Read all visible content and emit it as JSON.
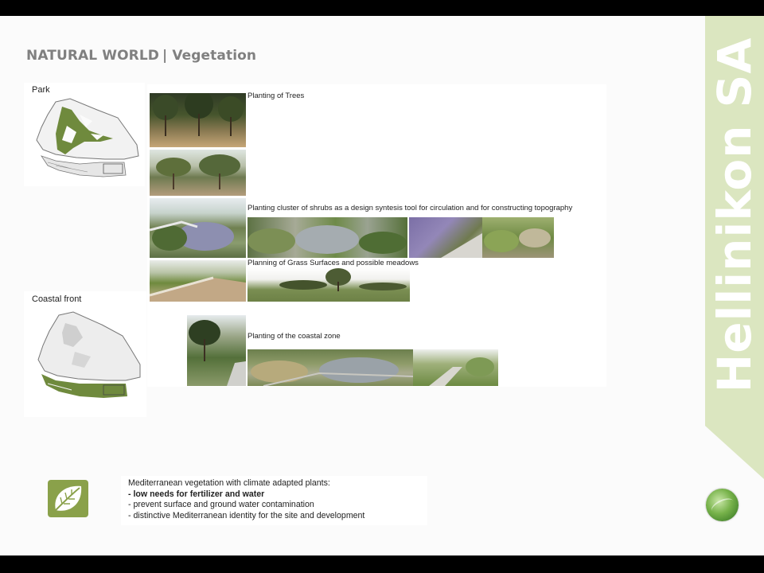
{
  "slide": {
    "title_main": "NATURAL WORLD",
    "title_sep": "|",
    "title_sub": "Vegetation",
    "brand": "Hellinikon SA"
  },
  "maps": {
    "park_label": "Park",
    "coastal_label": "Coastal front"
  },
  "captions": {
    "trees": "Planting of Trees",
    "shrubs": "Planting cluster of shrubs as a design syntesis tool for circulation and for constructing topography",
    "grass": "Planning of Grass Surfaces and possible meadows",
    "coastal": "Planting of the coastal zone"
  },
  "summary": {
    "intro": "Mediterranean vegetation with climate adapted plants:",
    "bullets": [
      "- low needs for fertilizer and water",
      "- prevent surface and ground water contamination",
      "- distinctive Mediterranean identity for the site and development"
    ]
  },
  "icons": {
    "leaf": "leaf-icon",
    "globe": "globe-logo-icon"
  },
  "colors": {
    "accent_green": "#8aa14a",
    "band_green": "#dbe6c0",
    "title_gray": "#808080"
  }
}
